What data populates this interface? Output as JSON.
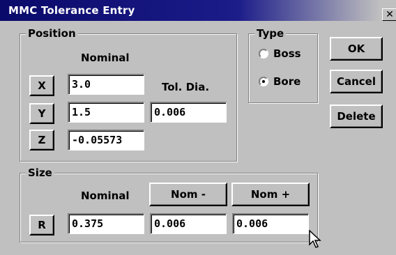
{
  "window": {
    "title": "MMC Tolerance Entry",
    "close_glyph": "✕"
  },
  "position": {
    "legend": "Position",
    "nominal_header": "Nominal",
    "tol_header": "Tol. Dia.",
    "x": {
      "button": "X",
      "value": "3.0"
    },
    "y": {
      "button": "Y",
      "value": "1.5"
    },
    "z": {
      "button": "Z",
      "value": "-0.05573"
    },
    "tol_value": "0.006"
  },
  "type": {
    "legend": "Type",
    "options": [
      {
        "label": "Boss",
        "checked": false
      },
      {
        "label": "Bore",
        "checked": true
      }
    ]
  },
  "actions": {
    "ok": "OK",
    "cancel": "Cancel",
    "delete": "Delete"
  },
  "size": {
    "legend": "Size",
    "nominal_header": "Nominal",
    "nom_minus_button": "Nom -",
    "nom_plus_button": "Nom +",
    "r_button": "R",
    "nominal_value": "0.375",
    "nom_minus_value": "0.006",
    "nom_plus_value": "0.006"
  },
  "icons": {
    "close": "close-icon",
    "cursor": "mouse-pointer-icon"
  }
}
